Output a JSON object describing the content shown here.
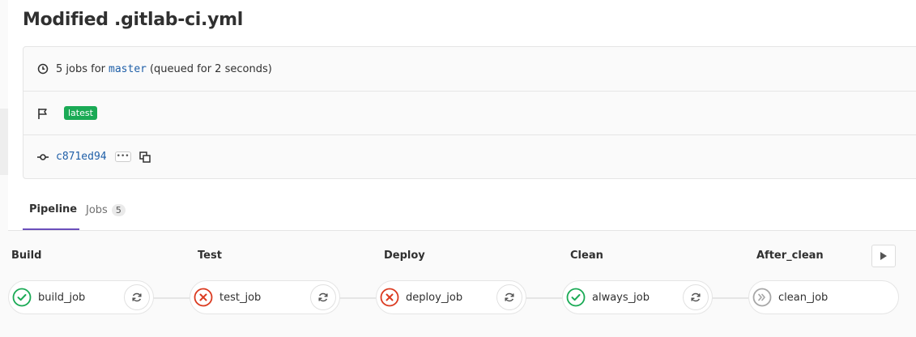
{
  "page": {
    "title": "Modified .gitlab-ci.yml"
  },
  "info": {
    "jobs_prefix": "5 jobs for",
    "branch": "master",
    "queued": "(queued for 2 seconds)",
    "tag": "latest",
    "commit_sha": "c871ed94",
    "ellipsis": "•••"
  },
  "tabs": [
    {
      "label": "Pipeline",
      "active": true
    },
    {
      "label": "Jobs",
      "count": "5",
      "active": false
    }
  ],
  "stages": [
    {
      "title": "Build",
      "job": "build_job",
      "status": "success"
    },
    {
      "title": "Test",
      "job": "test_job",
      "status": "failed"
    },
    {
      "title": "Deploy",
      "job": "deploy_job",
      "status": "failed"
    },
    {
      "title": "Clean",
      "job": "always_job",
      "status": "success"
    },
    {
      "title": "After_clean",
      "job": "clean_job",
      "status": "skipped"
    }
  ],
  "colors": {
    "success": "#1aaa55",
    "failed": "#db3b21",
    "skipped": "#a7a7a7",
    "link": "#1f5fa8",
    "tab_active": "#6b4fbb"
  },
  "icons": {
    "clock": "clock-icon",
    "flag": "flag-icon",
    "commit": "commit-icon",
    "copy": "copy-icon",
    "retry": "retry-icon",
    "play": "play-icon"
  }
}
